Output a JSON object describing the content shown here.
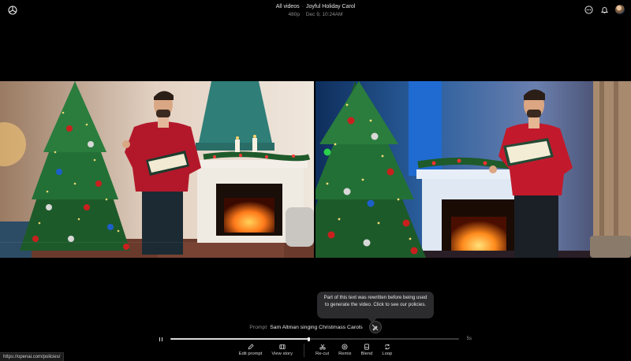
{
  "header": {
    "breadcrumb_parent": "All videos",
    "separator": "·",
    "video_title": "Joyful Holiday Carol",
    "resolution": "480p",
    "timestamp": "Dec 9, 10:24AM"
  },
  "top_icons": [
    "more-icon",
    "bell-icon",
    "avatar"
  ],
  "tooltip": {
    "text": "Part of this text was rewritten before being used to generate the video. Click to see our policies."
  },
  "prompt": {
    "label": "Prompt",
    "text": "Sam Altman singing Christmass Carols"
  },
  "player": {
    "progress": 0.48,
    "duration": "5s"
  },
  "toolbar": {
    "left": [
      {
        "name": "edit-prompt-button",
        "icon": "pencil-icon",
        "label": "Edit prompt"
      },
      {
        "name": "view-story-button",
        "icon": "storyboard-icon",
        "label": "View story"
      }
    ],
    "right": [
      {
        "name": "re-cut-button",
        "icon": "scissors-icon",
        "label": "Re-cut"
      },
      {
        "name": "remix-button",
        "icon": "remix-icon",
        "label": "Remix"
      },
      {
        "name": "blend-button",
        "icon": "blend-icon",
        "label": "Blend"
      },
      {
        "name": "loop-button",
        "icon": "loop-icon",
        "label": "Loop"
      }
    ]
  },
  "status_bar": {
    "url": "https://openai.com/policies/"
  },
  "colors": {
    "background": "#000000",
    "tooltip_bg": "#2c2c2e",
    "sweater_red": "#b3182a",
    "fire_orange": "#ff8a1c"
  }
}
